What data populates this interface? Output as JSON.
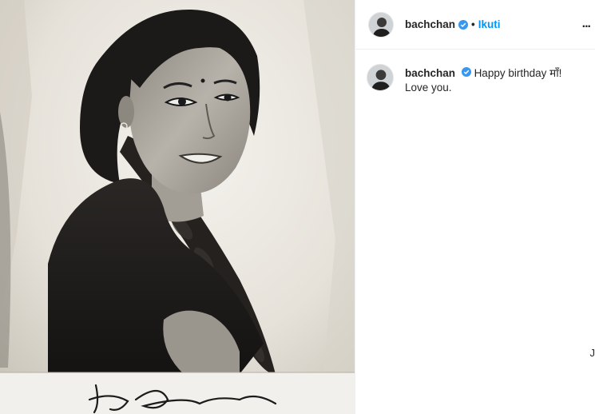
{
  "post": {
    "photo_signature": "Jaya Bhaduri",
    "username": "bachchan",
    "follow_label": "Ikuti",
    "header_separator": "•",
    "more_label": "...",
    "caption": {
      "username": "bachchan",
      "text": "Happy birthday माँ! Love you."
    },
    "edge_mark": "J"
  },
  "colors": {
    "link_blue": "#0095f6",
    "verified_blue": "#3897f0",
    "text": "#262626",
    "divider": "#efefef"
  },
  "icons": {
    "verified": "verified-badge-icon",
    "more": "more-options-icon"
  }
}
